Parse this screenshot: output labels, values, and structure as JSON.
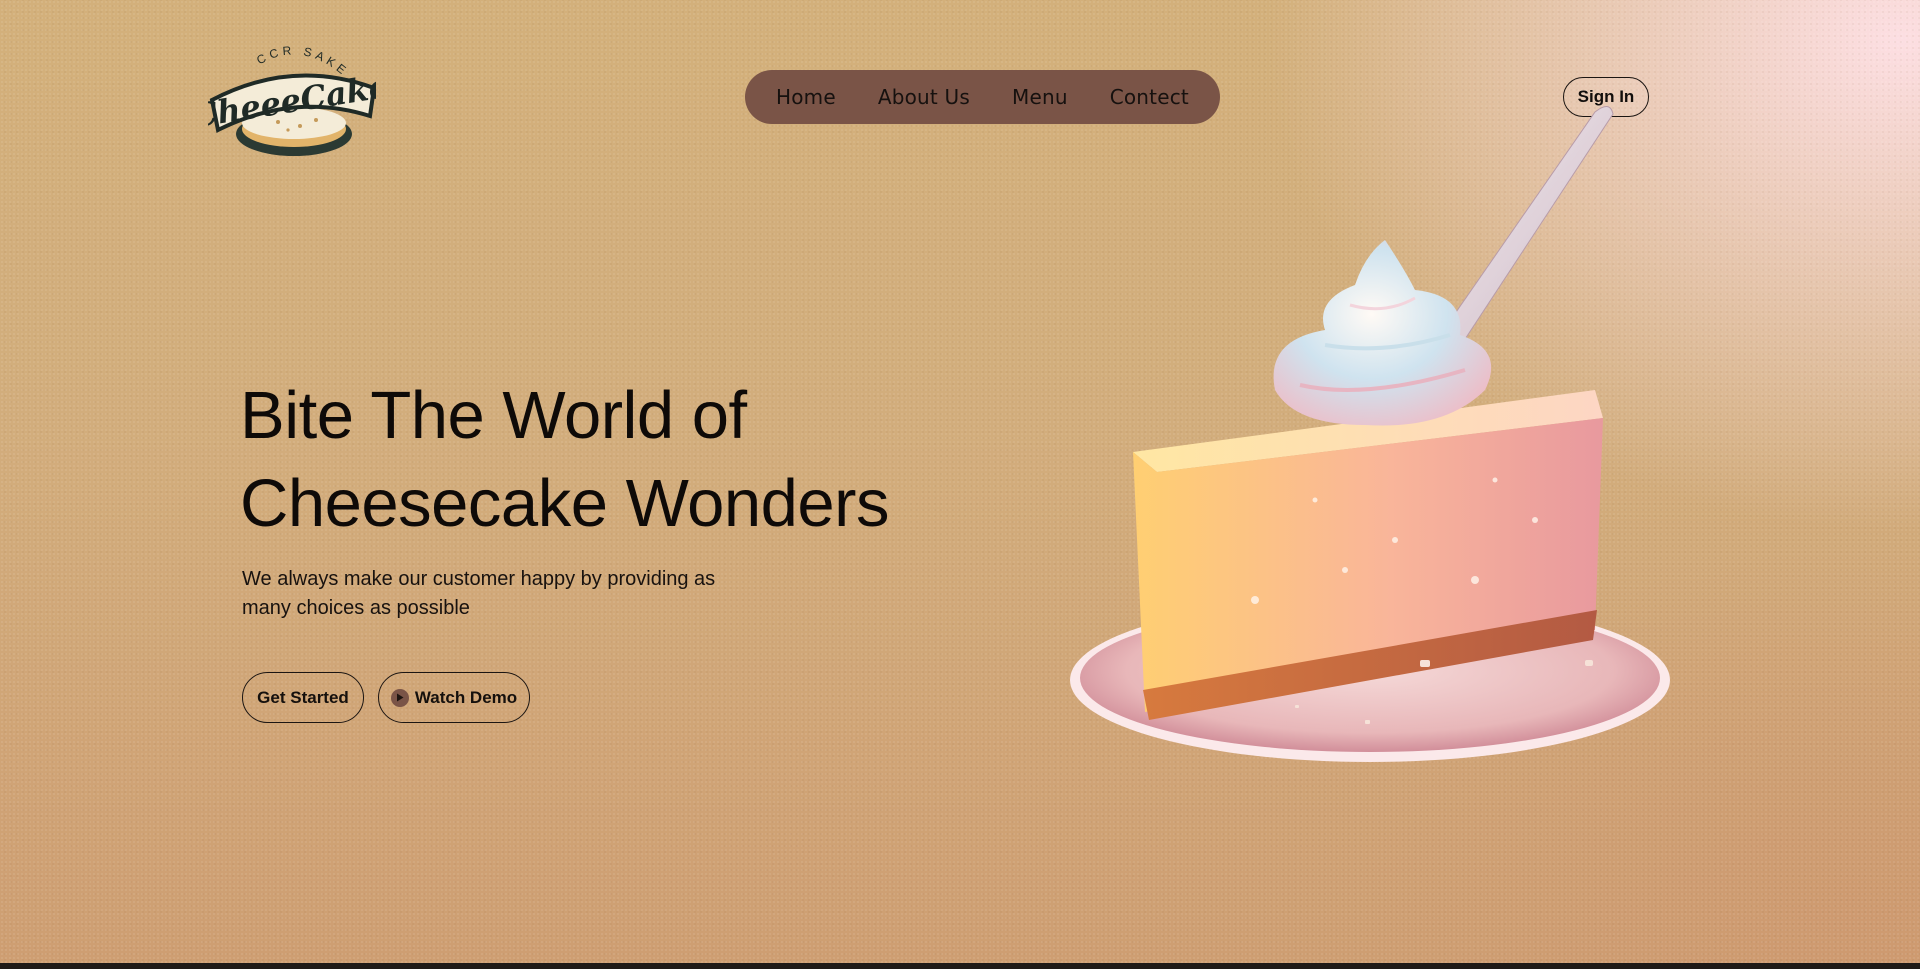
{
  "brand": {
    "logo_arc_text": "CCR SAKEE",
    "logo_word": "CheeeCake"
  },
  "nav": {
    "items": [
      {
        "label": "Home"
      },
      {
        "label": "About Us"
      },
      {
        "label": "Menu"
      },
      {
        "label": "Contect"
      }
    ]
  },
  "header": {
    "signin_label": "Sign In"
  },
  "hero": {
    "title_line1": "Bite The World of",
    "title_line2": "Cheesecake Wonders",
    "subtitle": "We always make our customer happy by providing as many choices as possible",
    "get_started_label": "Get Started",
    "watch_demo_label": "Watch Demo"
  },
  "colors": {
    "accent": "#7a5447",
    "background_top": "#d3b07b",
    "text": "#0e0a08"
  },
  "icons": {
    "play": "play-icon"
  }
}
